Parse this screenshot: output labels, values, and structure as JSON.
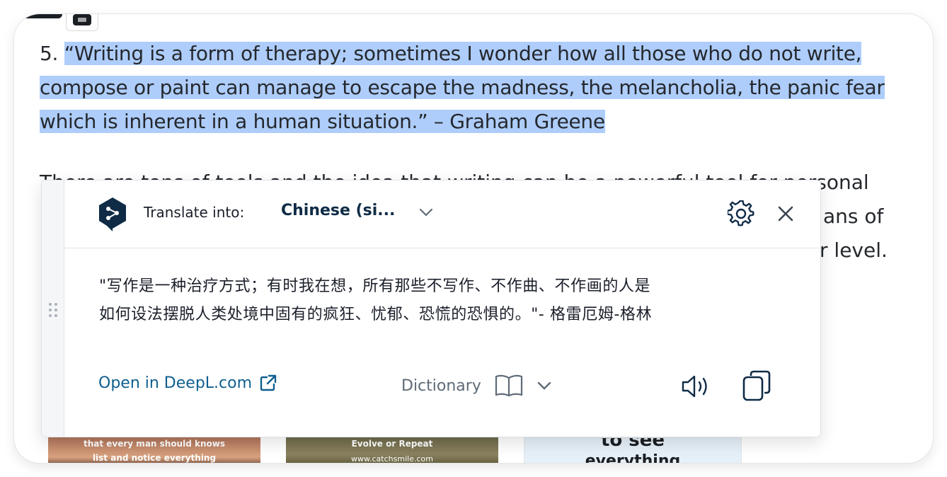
{
  "article": {
    "quote_number": "5.",
    "quote_lines": [
      "“Writing is a form of therapy; sometimes I wonder how all those who do not write,",
      "compose or paint can manage to escape the madness, the melancholia, the panic fear",
      "which is inherent in a human situation.” – Graham Greene"
    ],
    "partial_line_1": "There are tons of tools and the idea that writing can be a powerful tool for personal",
    "partial_line_2_tail": "ans of",
    "partial_line_3_tail": "r level."
  },
  "thumbnails": [
    {
      "caption": "that every man should knows",
      "subcaption": "list and notice everything"
    },
    {
      "caption": "Evolve or Repeat",
      "subcaption": "www.catchsmile.com"
    },
    {
      "caption": "to see",
      "subcaption": "everything"
    }
  ],
  "popup": {
    "translate_label": "Translate into:",
    "target_language": "Chinese (si...",
    "translation_lines": [
      "\"写作是一种治疗方式；有时我在想，所有那些不写作、不作曲、不作画的人是",
      "如何设法摆脱人类处境中固有的疯狂、忧郁、恐慌的恐惧的。\"- 格雷厄姆-格林"
    ],
    "open_link": "Open in DeepL.com",
    "dictionary_label": "Dictionary",
    "icons": {
      "logo": "deepl-logo",
      "language_dropdown": "chevron-down-icon",
      "settings": "gear-icon",
      "close": "close-icon",
      "external": "external-link-icon",
      "dictionary": "book-icon",
      "dictionary_dropdown": "chevron-down-icon",
      "speak": "speaker-icon",
      "copy": "copy-icon",
      "drag": "drag-handle-icon"
    },
    "colors": {
      "brand": "#0f2b46",
      "link": "#0f5f8f",
      "highlight": "#aecdfb"
    }
  }
}
